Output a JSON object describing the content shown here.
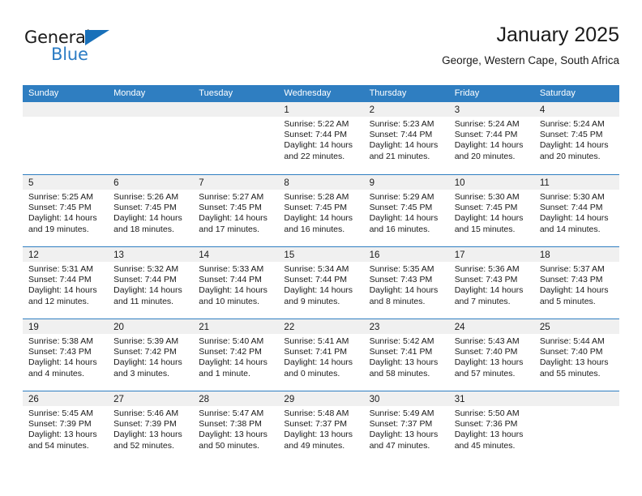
{
  "brand": {
    "word_one": "General",
    "word_two": "Blue",
    "triangle_icon": "triangle-icon",
    "blue": "#1870b9",
    "light_blue": "#2b7cc4"
  },
  "header": {
    "title": "January 2025",
    "subtitle": "George, Western Cape, South Africa"
  },
  "calendar": {
    "header_color": "#2f7ec1",
    "weekdays": [
      "Sunday",
      "Monday",
      "Tuesday",
      "Wednesday",
      "Thursday",
      "Friday",
      "Saturday"
    ],
    "weeks": [
      [
        {
          "day": "",
          "empty": true
        },
        {
          "day": "",
          "empty": true
        },
        {
          "day": "",
          "empty": true
        },
        {
          "day": "1",
          "sunrise": "Sunrise: 5:22 AM",
          "sunset": "Sunset: 7:44 PM",
          "daylight_1": "Daylight: 14 hours",
          "daylight_2": "and 22 minutes."
        },
        {
          "day": "2",
          "sunrise": "Sunrise: 5:23 AM",
          "sunset": "Sunset: 7:44 PM",
          "daylight_1": "Daylight: 14 hours",
          "daylight_2": "and 21 minutes."
        },
        {
          "day": "3",
          "sunrise": "Sunrise: 5:24 AM",
          "sunset": "Sunset: 7:44 PM",
          "daylight_1": "Daylight: 14 hours",
          "daylight_2": "and 20 minutes."
        },
        {
          "day": "4",
          "sunrise": "Sunrise: 5:24 AM",
          "sunset": "Sunset: 7:45 PM",
          "daylight_1": "Daylight: 14 hours",
          "daylight_2": "and 20 minutes."
        }
      ],
      [
        {
          "day": "5",
          "sunrise": "Sunrise: 5:25 AM",
          "sunset": "Sunset: 7:45 PM",
          "daylight_1": "Daylight: 14 hours",
          "daylight_2": "and 19 minutes."
        },
        {
          "day": "6",
          "sunrise": "Sunrise: 5:26 AM",
          "sunset": "Sunset: 7:45 PM",
          "daylight_1": "Daylight: 14 hours",
          "daylight_2": "and 18 minutes."
        },
        {
          "day": "7",
          "sunrise": "Sunrise: 5:27 AM",
          "sunset": "Sunset: 7:45 PM",
          "daylight_1": "Daylight: 14 hours",
          "daylight_2": "and 17 minutes."
        },
        {
          "day": "8",
          "sunrise": "Sunrise: 5:28 AM",
          "sunset": "Sunset: 7:45 PM",
          "daylight_1": "Daylight: 14 hours",
          "daylight_2": "and 16 minutes."
        },
        {
          "day": "9",
          "sunrise": "Sunrise: 5:29 AM",
          "sunset": "Sunset: 7:45 PM",
          "daylight_1": "Daylight: 14 hours",
          "daylight_2": "and 16 minutes."
        },
        {
          "day": "10",
          "sunrise": "Sunrise: 5:30 AM",
          "sunset": "Sunset: 7:45 PM",
          "daylight_1": "Daylight: 14 hours",
          "daylight_2": "and 15 minutes."
        },
        {
          "day": "11",
          "sunrise": "Sunrise: 5:30 AM",
          "sunset": "Sunset: 7:44 PM",
          "daylight_1": "Daylight: 14 hours",
          "daylight_2": "and 14 minutes."
        }
      ],
      [
        {
          "day": "12",
          "sunrise": "Sunrise: 5:31 AM",
          "sunset": "Sunset: 7:44 PM",
          "daylight_1": "Daylight: 14 hours",
          "daylight_2": "and 12 minutes."
        },
        {
          "day": "13",
          "sunrise": "Sunrise: 5:32 AM",
          "sunset": "Sunset: 7:44 PM",
          "daylight_1": "Daylight: 14 hours",
          "daylight_2": "and 11 minutes."
        },
        {
          "day": "14",
          "sunrise": "Sunrise: 5:33 AM",
          "sunset": "Sunset: 7:44 PM",
          "daylight_1": "Daylight: 14 hours",
          "daylight_2": "and 10 minutes."
        },
        {
          "day": "15",
          "sunrise": "Sunrise: 5:34 AM",
          "sunset": "Sunset: 7:44 PM",
          "daylight_1": "Daylight: 14 hours",
          "daylight_2": "and 9 minutes."
        },
        {
          "day": "16",
          "sunrise": "Sunrise: 5:35 AM",
          "sunset": "Sunset: 7:43 PM",
          "daylight_1": "Daylight: 14 hours",
          "daylight_2": "and 8 minutes."
        },
        {
          "day": "17",
          "sunrise": "Sunrise: 5:36 AM",
          "sunset": "Sunset: 7:43 PM",
          "daylight_1": "Daylight: 14 hours",
          "daylight_2": "and 7 minutes."
        },
        {
          "day": "18",
          "sunrise": "Sunrise: 5:37 AM",
          "sunset": "Sunset: 7:43 PM",
          "daylight_1": "Daylight: 14 hours",
          "daylight_2": "and 5 minutes."
        }
      ],
      [
        {
          "day": "19",
          "sunrise": "Sunrise: 5:38 AM",
          "sunset": "Sunset: 7:43 PM",
          "daylight_1": "Daylight: 14 hours",
          "daylight_2": "and 4 minutes."
        },
        {
          "day": "20",
          "sunrise": "Sunrise: 5:39 AM",
          "sunset": "Sunset: 7:42 PM",
          "daylight_1": "Daylight: 14 hours",
          "daylight_2": "and 3 minutes."
        },
        {
          "day": "21",
          "sunrise": "Sunrise: 5:40 AM",
          "sunset": "Sunset: 7:42 PM",
          "daylight_1": "Daylight: 14 hours",
          "daylight_2": "and 1 minute."
        },
        {
          "day": "22",
          "sunrise": "Sunrise: 5:41 AM",
          "sunset": "Sunset: 7:41 PM",
          "daylight_1": "Daylight: 14 hours",
          "daylight_2": "and 0 minutes."
        },
        {
          "day": "23",
          "sunrise": "Sunrise: 5:42 AM",
          "sunset": "Sunset: 7:41 PM",
          "daylight_1": "Daylight: 13 hours",
          "daylight_2": "and 58 minutes."
        },
        {
          "day": "24",
          "sunrise": "Sunrise: 5:43 AM",
          "sunset": "Sunset: 7:40 PM",
          "daylight_1": "Daylight: 13 hours",
          "daylight_2": "and 57 minutes."
        },
        {
          "day": "25",
          "sunrise": "Sunrise: 5:44 AM",
          "sunset": "Sunset: 7:40 PM",
          "daylight_1": "Daylight: 13 hours",
          "daylight_2": "and 55 minutes."
        }
      ],
      [
        {
          "day": "26",
          "sunrise": "Sunrise: 5:45 AM",
          "sunset": "Sunset: 7:39 PM",
          "daylight_1": "Daylight: 13 hours",
          "daylight_2": "and 54 minutes."
        },
        {
          "day": "27",
          "sunrise": "Sunrise: 5:46 AM",
          "sunset": "Sunset: 7:39 PM",
          "daylight_1": "Daylight: 13 hours",
          "daylight_2": "and 52 minutes."
        },
        {
          "day": "28",
          "sunrise": "Sunrise: 5:47 AM",
          "sunset": "Sunset: 7:38 PM",
          "daylight_1": "Daylight: 13 hours",
          "daylight_2": "and 50 minutes."
        },
        {
          "day": "29",
          "sunrise": "Sunrise: 5:48 AM",
          "sunset": "Sunset: 7:37 PM",
          "daylight_1": "Daylight: 13 hours",
          "daylight_2": "and 49 minutes."
        },
        {
          "day": "30",
          "sunrise": "Sunrise: 5:49 AM",
          "sunset": "Sunset: 7:37 PM",
          "daylight_1": "Daylight: 13 hours",
          "daylight_2": "and 47 minutes."
        },
        {
          "day": "31",
          "sunrise": "Sunrise: 5:50 AM",
          "sunset": "Sunset: 7:36 PM",
          "daylight_1": "Daylight: 13 hours",
          "daylight_2": "and 45 minutes."
        },
        {
          "day": "",
          "empty": true
        }
      ]
    ]
  }
}
